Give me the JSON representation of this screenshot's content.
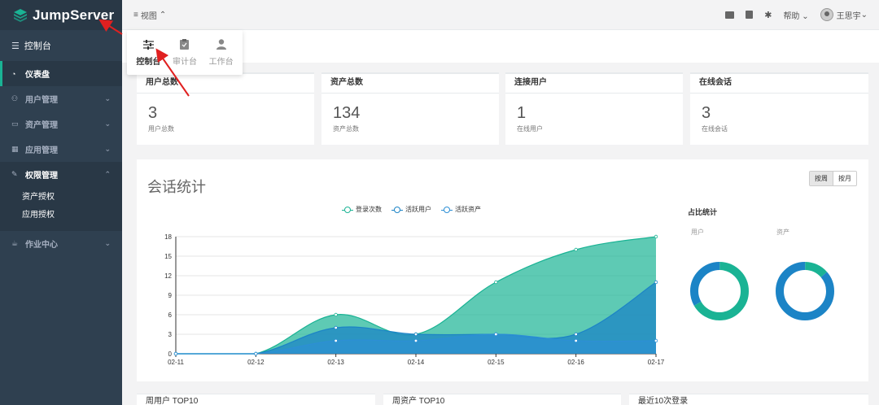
{
  "brand": {
    "name": "JumpServer"
  },
  "sidebar": {
    "console_label": "控制台",
    "items": [
      {
        "label": "仪表盘",
        "icon": "dashboard-icon"
      },
      {
        "label": "用户管理",
        "icon": "users-icon"
      },
      {
        "label": "资产管理",
        "icon": "inbox-icon"
      },
      {
        "label": "应用管理",
        "icon": "grid-icon"
      },
      {
        "label": "权限管理",
        "icon": "edit-icon"
      },
      {
        "label": "作业中心",
        "icon": "coffee-icon"
      }
    ],
    "submenu": [
      "资产授权",
      "应用授权"
    ]
  },
  "topbar": {
    "view_label": "视图",
    "help_label": "帮助",
    "username": "王思宇"
  },
  "view_dropdown": {
    "items": [
      {
        "label": "控制台",
        "icon": "sliders-icon"
      },
      {
        "label": "审计台",
        "icon": "clipboard-icon"
      },
      {
        "label": "工作台",
        "icon": "user-icon"
      }
    ]
  },
  "cards": [
    {
      "title": "用户总数",
      "value": "3",
      "sub": "用户总数"
    },
    {
      "title": "资产总数",
      "value": "134",
      "sub": "资产总数"
    },
    {
      "title": "连接用户",
      "value": "1",
      "sub": "在线用户"
    },
    {
      "title": "在线会话",
      "value": "3",
      "sub": "在线会话"
    }
  ],
  "session_panel": {
    "title": "会话统计",
    "toggle": [
      "按周",
      "按月"
    ],
    "ratio_title": "占比统计",
    "ratio_labels": [
      "用户",
      "资产"
    ]
  },
  "bottom_cards": [
    "周用户 TOP10",
    "周资产 TOP10",
    "最近10次登录"
  ],
  "colors": {
    "accent": "#1ab394",
    "sidebar": "#2f4050",
    "series1": "#1ab394",
    "series2": "#1c84c6",
    "series3": "#2d8fd5"
  },
  "chart_data": {
    "type": "area",
    "x": [
      "02-11",
      "02-12",
      "02-13",
      "02-14",
      "02-15",
      "02-16",
      "02-17"
    ],
    "ylim": [
      0,
      18
    ],
    "yticks": [
      0,
      3,
      6,
      9,
      12,
      15,
      18
    ],
    "legend_position": "top",
    "series": [
      {
        "name": "登录次数",
        "values": [
          0,
          0,
          6,
          3,
          11,
          16,
          18
        ],
        "color": "#1ab394"
      },
      {
        "name": "活跃用户",
        "values": [
          0,
          0,
          4,
          3,
          3,
          3,
          11
        ],
        "color": "#1c84c6"
      },
      {
        "name": "活跃资产",
        "values": [
          0,
          0,
          2,
          2,
          3,
          2,
          2
        ],
        "color": "#2d8fd5"
      }
    ],
    "donuts": [
      {
        "label": "用户",
        "values": [
          2,
          1
        ],
        "colors": [
          "#1ab394",
          "#1c84c6"
        ]
      },
      {
        "label": "资产",
        "values": [
          18,
          116
        ],
        "colors": [
          "#1ab394",
          "#1c84c6"
        ]
      }
    ]
  }
}
